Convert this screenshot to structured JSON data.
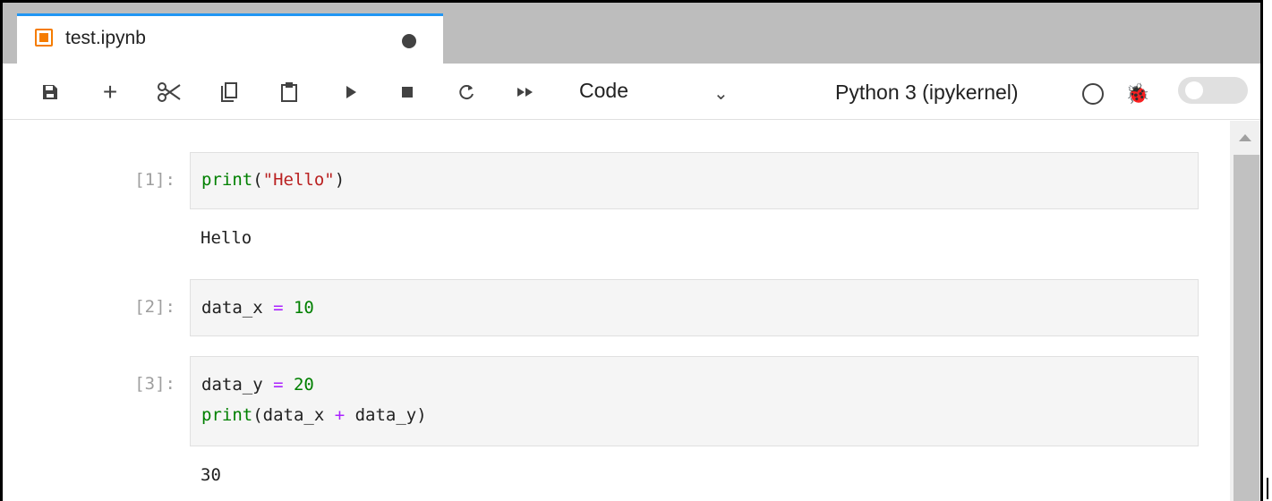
{
  "tab": {
    "title": "test.ipynb",
    "icon": "notebook-icon",
    "unsaved": true
  },
  "toolbar": {
    "buttons": [
      {
        "name": "save-button",
        "icon": "save-icon",
        "glyph": "🖫"
      },
      {
        "name": "insert-cell-button",
        "icon": "plus-icon",
        "glyph": "+"
      },
      {
        "name": "cut-button",
        "icon": "scissors-icon",
        "glyph": "✂"
      },
      {
        "name": "copy-button",
        "icon": "copy-icon",
        "glyph": "⧉"
      },
      {
        "name": "paste-button",
        "icon": "paste-icon",
        "glyph": "📋"
      },
      {
        "name": "run-button",
        "icon": "play-icon",
        "glyph": "▶"
      },
      {
        "name": "stop-button",
        "icon": "stop-icon",
        "glyph": "■"
      },
      {
        "name": "restart-button",
        "icon": "restart-icon",
        "glyph": "↻"
      },
      {
        "name": "run-all-button",
        "icon": "fast-forward-icon",
        "glyph": "⏩"
      }
    ],
    "cell_type": "Code",
    "kernel": "Python 3 (ipykernel)"
  },
  "cells": [
    {
      "prompt": "[1]:",
      "lines": [
        "print(\"Hello\")"
      ],
      "output": "Hello"
    },
    {
      "prompt": "[2]:",
      "lines": [
        "data_x = 10"
      ],
      "output": ""
    },
    {
      "prompt": "[3]:",
      "lines": [
        "data_y = 20",
        "print(data_x + data_y)"
      ],
      "output": "30"
    }
  ],
  "colors": {
    "accent": "#2196f3",
    "keyword": "#008000",
    "string": "#ba2121",
    "operator": "#aa22ff",
    "notebook_icon": "#f57c00"
  }
}
